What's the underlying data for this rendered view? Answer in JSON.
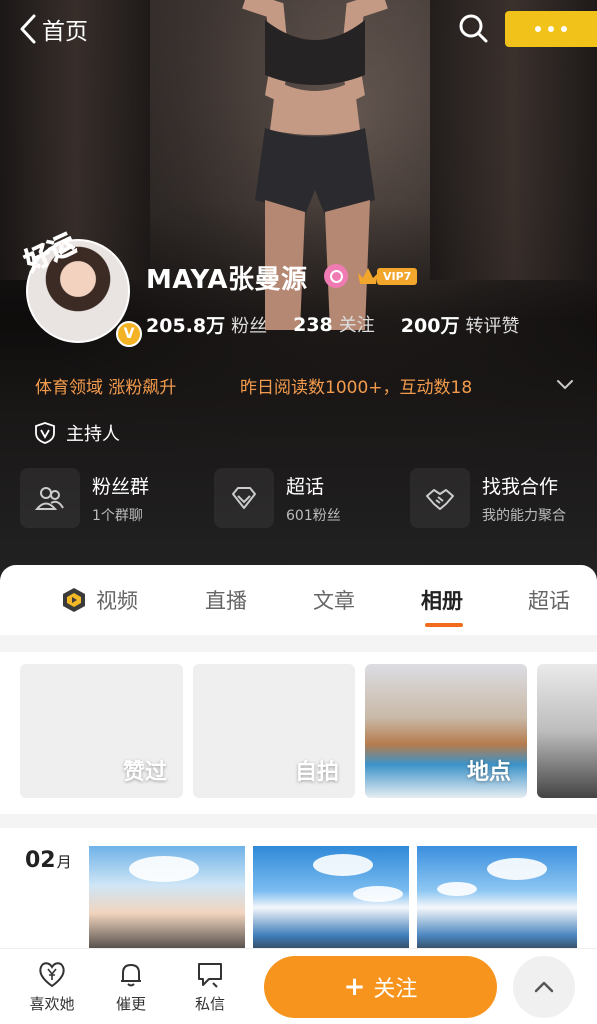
{
  "nav": {
    "back_label": "首页"
  },
  "profile": {
    "name": "MAYA张曼源",
    "vip_level": "VIP7",
    "badge_text": "好运",
    "verified_mark": "V",
    "stats": [
      {
        "value": "205.8万",
        "label": "粉丝"
      },
      {
        "value": "238",
        "label": "关注"
      },
      {
        "value": "200万",
        "label": "转评赞"
      }
    ],
    "tag_domain": "体育领域 涨粉飙升",
    "tag_reads": "昨日阅读数1000+，互动数18",
    "role": "主持人"
  },
  "cards": [
    {
      "title": "粉丝群",
      "subtitle": "1个群聊",
      "icon": "group-icon"
    },
    {
      "title": "超话",
      "subtitle": "601粉丝",
      "icon": "diamond-icon"
    },
    {
      "title": "找我合作",
      "subtitle": "我的能力聚合",
      "icon": "handshake-icon"
    }
  ],
  "tabs": [
    "视频",
    "直播",
    "文章",
    "相册",
    "超话"
  ],
  "active_tab": "相册",
  "albums": [
    {
      "caption": "赞过"
    },
    {
      "caption": "自拍"
    },
    {
      "caption": "地点"
    }
  ],
  "month": {
    "number": "02",
    "unit": "月"
  },
  "bottom": {
    "like_label": "喜欢她",
    "remind_label": "催更",
    "message_label": "私信",
    "follow_label": "关注",
    "follow_plus": "+"
  },
  "colors": {
    "accent": "#f7941d",
    "tag_orange": "#f39b4c",
    "more_button": "#f0c21a"
  }
}
